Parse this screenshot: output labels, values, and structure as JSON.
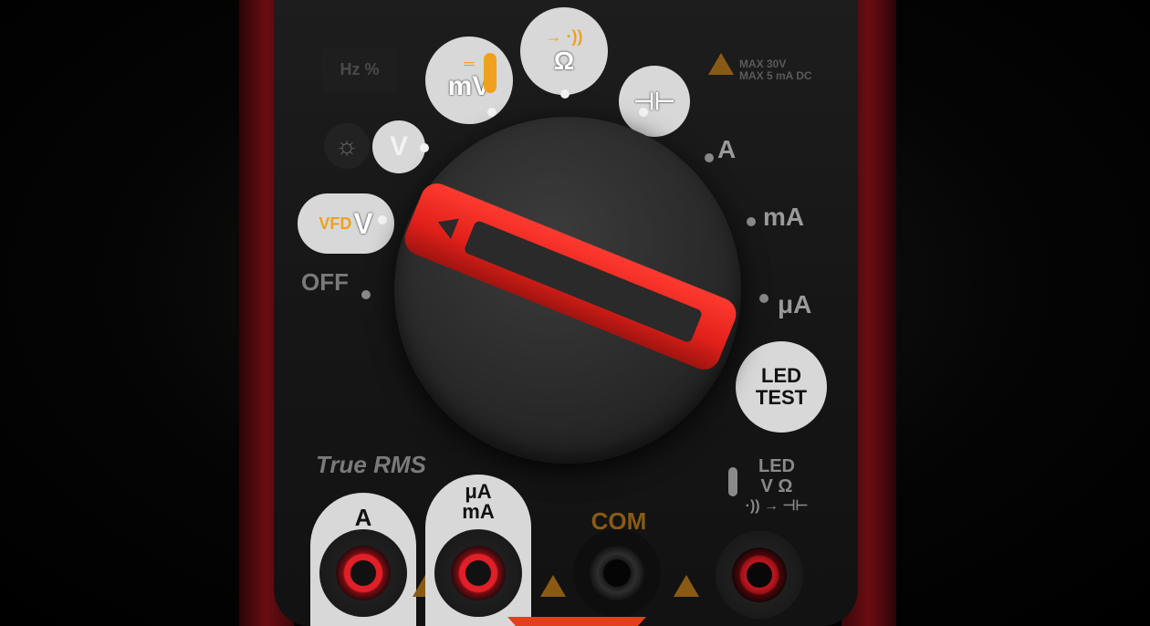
{
  "dial": {
    "hz_percent": "Hz %",
    "backlight_icon": "sun-icon",
    "v_dc": "V",
    "mv": "mV",
    "ohm": "Ω",
    "diode_continuity": "→ ·))",
    "capacitance": "⊣⊢",
    "amps": "A",
    "milliamps": "mA",
    "microamps": "μA",
    "led_test_line1": "LED",
    "led_test_line2": "TEST",
    "vfd": "VFD",
    "v_ac": "V",
    "off": "OFF",
    "warning_line1": "MAX 30V",
    "warning_line2": "MAX 5 mA DC"
  },
  "labels": {
    "true_rms": "True RMS",
    "jack_a": "A",
    "jack_ua_line1": "μA",
    "jack_ua_line2": "mA",
    "jack_com": "COM",
    "jack_right_line1": "LED",
    "jack_right_line2": "V Ω",
    "jack_right_line3": "·)) → ⊣⊢"
  },
  "colors": {
    "accent_red": "#e0201a",
    "accent_orange": "#f0a020",
    "label_gray": "#9a9a9a"
  }
}
